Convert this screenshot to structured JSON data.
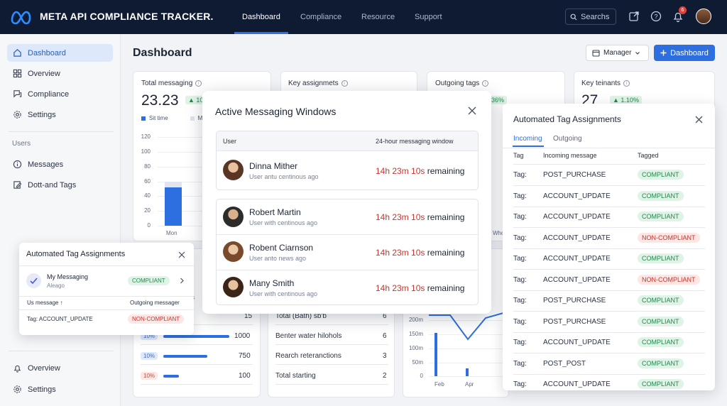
{
  "app": {
    "title": "META API COMPLIANCE TRACKER."
  },
  "topnav": {
    "items": [
      "Dashboard",
      "Compliance",
      "Resource",
      "Support"
    ],
    "active": "Dashboard"
  },
  "search": {
    "label": "Searchs"
  },
  "notifications": {
    "count": "6"
  },
  "sidebar": {
    "items": [
      "Dashboard",
      "Overview",
      "Compliance",
      "Settings"
    ],
    "section_label": "Users",
    "user_items": [
      "Messages",
      "Dott-and Tags"
    ],
    "bottom_items": [
      "Overview",
      "Settings"
    ]
  },
  "page": {
    "title": "Dashboard",
    "manager_select": "Manager",
    "dashboard_button": "Dashboard"
  },
  "cards": {
    "total_messaging": {
      "title": "Total messaging",
      "value": "23.23",
      "delta": "10",
      "legend": [
        "Sit time",
        "M"
      ]
    },
    "key_assignments": {
      "title": "Key assignmets"
    },
    "outgoing_tags": {
      "title": "Outgoing tags",
      "delta": "36%"
    },
    "key_tenants": {
      "title": "Key teinants",
      "value": "27",
      "delta": "1.10%"
    }
  },
  "chart_data": {
    "type": "bar",
    "categories": [
      "Mon"
    ],
    "series": [
      {
        "values": [
          52
        ]
      }
    ],
    "ylim": [
      0,
      120
    ],
    "yticks": [
      "120",
      "100",
      "80",
      "60",
      "40",
      "20",
      "0"
    ]
  },
  "left_list": {
    "rows": [
      {
        "pct": "",
        "value": "15"
      },
      {
        "pct": "10%",
        "value": "1000"
      },
      {
        "pct": "10%",
        "value": "750"
      },
      {
        "pct": "10%",
        "value": "100"
      }
    ],
    "fragment": "s"
  },
  "mid_list": {
    "rows": [
      {
        "label": "Total (Bath) sb'b",
        "value": "6"
      },
      {
        "label": "Benter water hilohols",
        "value": "6"
      },
      {
        "label": "Rearch reteranctions",
        "value": "3"
      },
      {
        "label": "Total starting",
        "value": "2"
      }
    ]
  },
  "third_chart": {
    "yticks": [
      "200m",
      "150m",
      "100m",
      "50m",
      "0"
    ],
    "xticks": [
      "Feb",
      "Apr"
    ],
    "fragment": "Who"
  },
  "modal": {
    "title": "Active Messaging Windows",
    "col_user": "User",
    "col_window": "24-hour messaging window",
    "users": [
      {
        "name": "Dinna Mither",
        "sub": "User antu centinous ago",
        "time": "14h 23m 10s",
        "suffix": "remaining"
      },
      {
        "name": "Robert Martin",
        "sub": "User with centinous ago",
        "time": "14h 23m 10s",
        "suffix": "remaining"
      },
      {
        "name": "Robent Ciarnson",
        "sub": "User anto news ago",
        "time": "14h 23m 10s",
        "suffix": "remaining"
      },
      {
        "name": "Many Smith",
        "sub": "User with centinous ago",
        "time": "14h 23m 10s",
        "suffix": "remaining"
      }
    ]
  },
  "right_panel": {
    "title": "Automated Tag Assignments",
    "tabs": [
      "Incoming",
      "Outgoing"
    ],
    "headers": [
      "Tag",
      "Incoming message",
      "Tagged"
    ],
    "rows": [
      {
        "tag": "Tag:",
        "message": "POST_PURCHASE",
        "status": "COMPLIANT",
        "ok": true
      },
      {
        "tag": "Tag:",
        "message": "ACCOUNT_UPDATE",
        "status": "COMPLIANT",
        "ok": true
      },
      {
        "tag": "Tag:",
        "message": "ACCOUNT_UPDATE",
        "status": "COMPLIANT",
        "ok": true
      },
      {
        "tag": "Tag:",
        "message": "ACCOUNT_UPDATE",
        "status": "NON-COMPLIANT",
        "ok": false
      },
      {
        "tag": "Tag:",
        "message": "ACCOUNT_UPDATE",
        "status": "COMPLIANT",
        "ok": true
      },
      {
        "tag": "Tag:",
        "message": "ACCOUNT_UPDATE",
        "status": "NON-COMPLIANT",
        "ok": false
      },
      {
        "tag": "Tag:",
        "message": "POST_PURCHASE",
        "status": "COMPLIANT",
        "ok": true
      },
      {
        "tag": "Tag:",
        "message": "POST_PURCHASE",
        "status": "COMPLIANT",
        "ok": true
      },
      {
        "tag": "Tag:",
        "message": "ACCOUNT_UPDATE",
        "status": "COMPLIANT",
        "ok": true
      },
      {
        "tag": "Tag:",
        "message": "POST_POST",
        "status": "COMPLIANT",
        "ok": true
      },
      {
        "tag": "Tag:",
        "message": "ACCOUNT_UPDATE",
        "status": "COMPLIANT",
        "ok": true
      }
    ]
  },
  "left_panel": {
    "title": "Automated Tag Assignments",
    "item_title": "My Messaging",
    "item_sub": "Aleago",
    "item_status": "COMPLIANT",
    "col_left": "Us message ↑",
    "col_right": "Outgoing messager",
    "row_tag": "Tag: ACCOUNT_UPDATE",
    "row_status": "NON-COMPLIANT"
  },
  "colors": {
    "accent": "#2d6fe0",
    "topbar": "#0f1b33",
    "compliant": "#1f8a4c",
    "noncompliant": "#c4372f"
  }
}
